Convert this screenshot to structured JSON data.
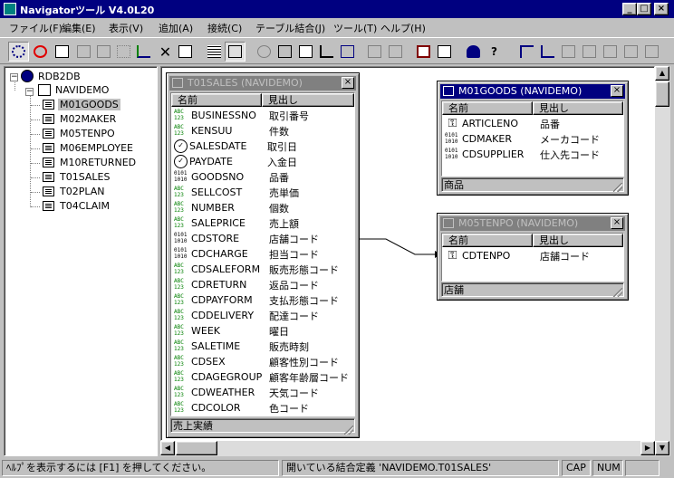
{
  "window": {
    "title": "Navigatorツール V4.0L20",
    "controls": {
      "minimize": "_",
      "maximize": "□",
      "close": "×"
    }
  },
  "menu": [
    {
      "label": "ファイル(F)"
    },
    {
      "label": "編集(E)"
    },
    {
      "label": "表示(V)"
    },
    {
      "label": "追加(A)"
    },
    {
      "label": "接続(C)"
    },
    {
      "label": "テーブル結合(J)"
    },
    {
      "label": "ツール(T)"
    },
    {
      "label": "ヘルプ(H)"
    }
  ],
  "tree": {
    "root": "RDB2DB",
    "schema": "NAVIDEMO",
    "tables": [
      "M01GOODS",
      "M02MAKER",
      "M05TENPO",
      "M06EMPLOYEE",
      "M10RETURNED",
      "T01SALES",
      "T02PLAN",
      "T04CLAIM"
    ],
    "selected": "M01GOODS"
  },
  "entities": {
    "t01sales": {
      "title": "T01SALES (NAVIDEMO)",
      "col_name": "名前",
      "col_caption": "見出し",
      "footer": "売上実績",
      "rows": [
        {
          "type": "abc",
          "name": "BUSINESSNO",
          "caption": "取引番号"
        },
        {
          "type": "abc",
          "name": "KENSUU",
          "caption": "件数"
        },
        {
          "type": "date",
          "name": "SALESDATE",
          "caption": "取引日"
        },
        {
          "type": "date",
          "name": "PAYDATE",
          "caption": "入金日"
        },
        {
          "type": "num",
          "name": "GOODSNO",
          "caption": "品番"
        },
        {
          "type": "abc",
          "name": "SELLCOST",
          "caption": "売単価"
        },
        {
          "type": "abc",
          "name": "NUMBER",
          "caption": "個数"
        },
        {
          "type": "abc",
          "name": "SALEPRICE",
          "caption": "売上額"
        },
        {
          "type": "num",
          "name": "CDSTORE",
          "caption": "店舗コード"
        },
        {
          "type": "num",
          "name": "CDCHARGE",
          "caption": "担当コード"
        },
        {
          "type": "abc",
          "name": "CDSALEFORM",
          "caption": "販売形態コード"
        },
        {
          "type": "abc",
          "name": "CDRETURN",
          "caption": "返品コード"
        },
        {
          "type": "abc",
          "name": "CDPAYFORM",
          "caption": "支払形態コード"
        },
        {
          "type": "abc",
          "name": "CDDELIVERY",
          "caption": "配達コード"
        },
        {
          "type": "abc",
          "name": "WEEK",
          "caption": "曜日"
        },
        {
          "type": "abc",
          "name": "SALETIME",
          "caption": "販売時刻"
        },
        {
          "type": "abc",
          "name": "CDSEX",
          "caption": "顧客性別コード"
        },
        {
          "type": "abc",
          "name": "CDAGEGROUP",
          "caption": "顧客年齢層コード"
        },
        {
          "type": "abc",
          "name": "CDWEATHER",
          "caption": "天気コード"
        },
        {
          "type": "abc",
          "name": "CDCOLOR",
          "caption": "色コード"
        }
      ]
    },
    "m01goods": {
      "title": "M01GOODS (NAVIDEMO)",
      "col_name": "名前",
      "col_caption": "見出し",
      "footer": "商品",
      "rows": [
        {
          "type": "key",
          "name": "ARTICLENO",
          "caption": "品番"
        },
        {
          "type": "num",
          "name": "CDMAKER",
          "caption": "メーカコード"
        },
        {
          "type": "num",
          "name": "CDSUPPLIER",
          "caption": "仕入先コード"
        }
      ]
    },
    "m05tenpo": {
      "title": "M05TENPO (NAVIDEMO)",
      "col_name": "名前",
      "col_caption": "見出し",
      "footer": "店舗",
      "rows": [
        {
          "type": "key",
          "name": "CDTENPO",
          "caption": "店舗コード"
        }
      ]
    }
  },
  "type_glyphs": {
    "abc": "ABC\n123",
    "num": "0101\n1010",
    "date": "✓",
    "key": "⚿"
  },
  "status": {
    "help": "ﾍﾙﾌﾟを表示するには [F1] を押してください。",
    "open_def": "開いている結合定義 'NAVIDEMO.T01SALES'",
    "cap": "CAP",
    "num": "NUM"
  },
  "colors": {
    "title_active": "#000080",
    "title_inactive": "#808080",
    "window_bg": "#c0c0c0"
  }
}
